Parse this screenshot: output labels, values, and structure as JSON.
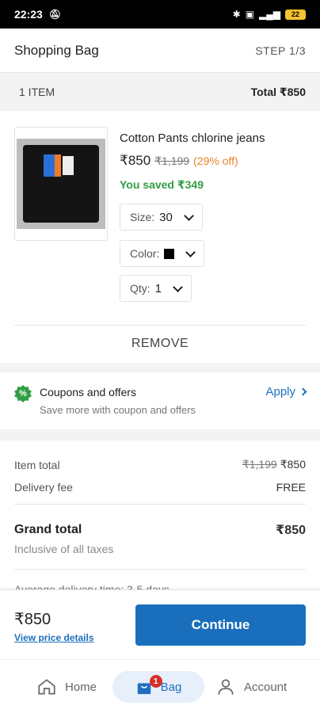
{
  "status_bar": {
    "time": "22:23",
    "battery": "22"
  },
  "header": {
    "title": "Shopping Bag",
    "step": "STEP 1/3"
  },
  "summary": {
    "items": "1 ITEM",
    "total": "Total ₹850"
  },
  "product": {
    "name": "Cotton Pants chlorine jeans",
    "price": "₹850",
    "mrp": "₹1,199",
    "discount": "(29% off)",
    "saved": "You saved ₹349",
    "size_label": "Size:",
    "size_value": "30",
    "color_label": "Color:",
    "color_value": "#000000",
    "qty_label": "Qty:",
    "qty_value": "1",
    "remove_label": "REMOVE"
  },
  "coupons": {
    "icon_text": "%",
    "title": "Coupons and offers",
    "subtitle": "Save more with coupon and offers",
    "apply_label": "Apply"
  },
  "price_details": {
    "item_total_label": "Item total",
    "item_total_mrp": "₹1,199",
    "item_total_value": "₹850",
    "delivery_label": "Delivery fee",
    "delivery_value": "FREE",
    "grand_total_label": "Grand total",
    "grand_total_value": "₹850",
    "taxes_note": "Inclusive of all taxes",
    "delivery_estimate_cut": "Average delivery time: 3-5 days"
  },
  "action_bar": {
    "amount": "₹850",
    "view_details": "View price details",
    "continue_label": "Continue"
  },
  "nav": {
    "home": "Home",
    "bag": "Bag",
    "bag_count": "1",
    "account": "Account"
  },
  "colors": {
    "accent": "#1a6fbd",
    "success": "#2f9e44",
    "discount": "#e8832b",
    "badge": "#d6302b"
  }
}
